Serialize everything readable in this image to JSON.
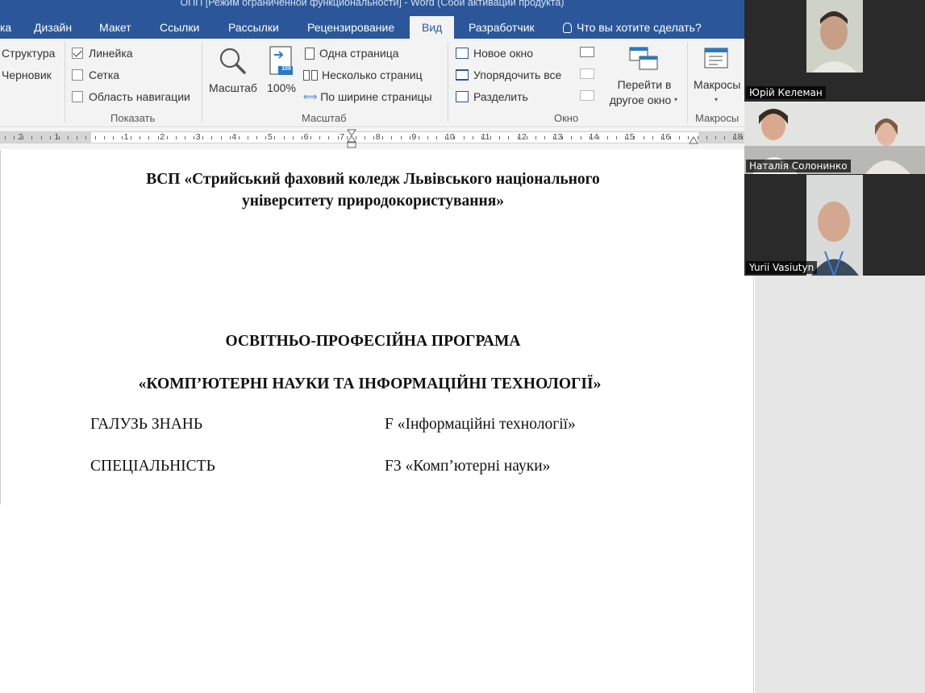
{
  "window": {
    "title": "ОПП [Режим ограниченной функциональности] - Word (Сбой активации продукта)"
  },
  "tabs": [
    {
      "label": "ка"
    },
    {
      "label": "Дизайн"
    },
    {
      "label": "Макет"
    },
    {
      "label": "Ссылки"
    },
    {
      "label": "Рассылки"
    },
    {
      "label": "Рецензирование"
    },
    {
      "label": "Вид",
      "active": true
    },
    {
      "label": "Разработчик"
    }
  ],
  "tell_me": "Что вы хотите сделать?",
  "ribbon": {
    "views": {
      "structure": "Структура",
      "draft": "Черновик"
    },
    "show": {
      "label": "Показать",
      "ruler": {
        "label": "Линейка",
        "checked": true
      },
      "grid": {
        "label": "Сетка",
        "checked": false
      },
      "nav_pane": {
        "label": "Область навигации",
        "checked": false
      }
    },
    "zoom": {
      "label": "Масштаб",
      "zoom_button": "Масштаб",
      "hundred": "100%",
      "hundred_icon_text": "100",
      "one_page": "Одна страница",
      "multiple_pages": "Несколько страниц",
      "page_width": "По ширине страницы"
    },
    "window": {
      "label": "Окно",
      "new_window": "Новое окно",
      "arrange_all": "Упорядочить все",
      "split": "Разделить",
      "switch_line1": "Перейти в",
      "switch_line2": "другое окно"
    },
    "macros": {
      "label": "Макросы",
      "button": "Макросы"
    }
  },
  "ruler": {
    "left_numbers": [
      "2",
      "1"
    ],
    "numbers": [
      "1",
      "2",
      "3",
      "4",
      "5",
      "6",
      "7",
      "8",
      "9",
      "10",
      "11",
      "12",
      "13",
      "14",
      "15",
      "16",
      "18"
    ]
  },
  "document": {
    "header_line1": "ВСП «Стрийський фаховий коледж Львівського національного",
    "header_line2": "університету природокористування»",
    "program_title": "ОСВІТНЬО-ПРОФЕСІЙНА ПРОГРАМА",
    "program_name": "«КОМП’ЮТЕРНІ НАУКИ ТА ІНФОРМАЦІЙНІ ТЕХНОЛОГІЇ»",
    "rows": [
      {
        "label": "ГАЛУЗЬ ЗНАНЬ",
        "value": "F «Інформаційні технології»"
      },
      {
        "label": "СПЕЦІАЛЬНІСТЬ",
        "value": "F3 «Комп’ютерні науки»"
      }
    ]
  },
  "participants": [
    {
      "name": "Юрій Келеман"
    },
    {
      "name": "Наталія Солонинко"
    },
    {
      "name": "Yurii Vasiutyn"
    }
  ],
  "colors": {
    "word_blue": "#2b579a",
    "ribbon_bg": "#f3f3f3"
  }
}
